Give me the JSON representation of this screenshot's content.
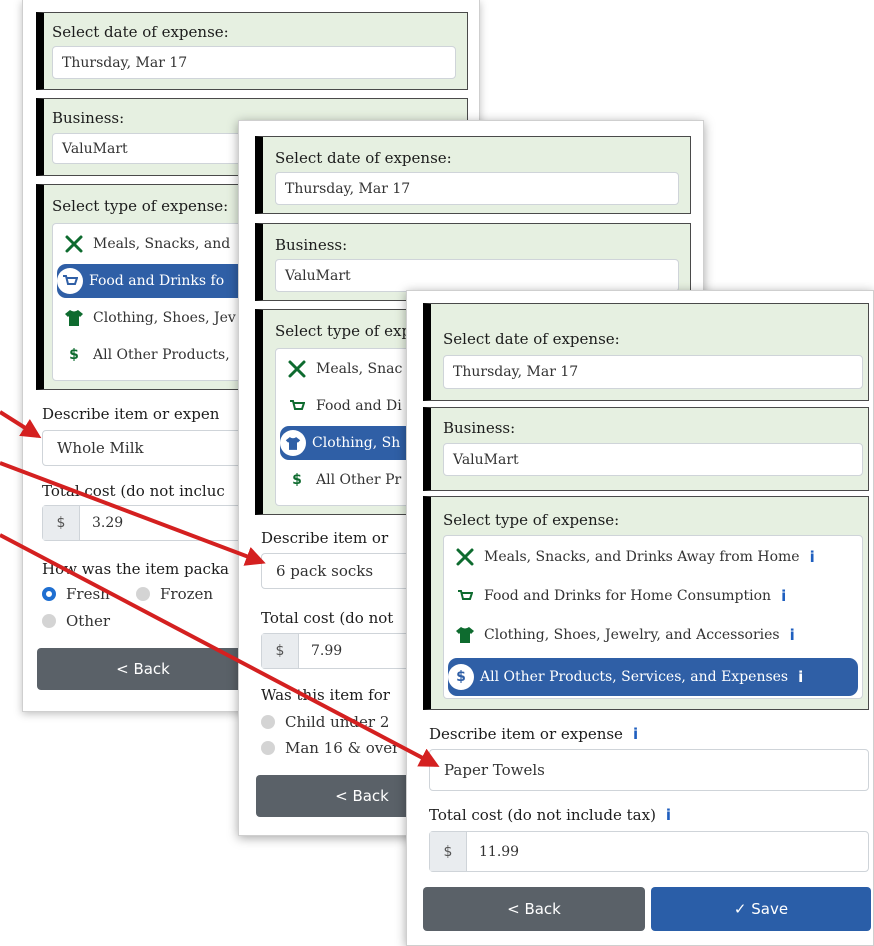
{
  "panel1": {
    "date_label": "Select date of expense:",
    "date_value": "Thursday, Mar 17",
    "business_label": "Business:",
    "business_value": "ValuMart",
    "type_label": "Select type of expense:",
    "options": [
      {
        "label": "Meals, Snacks, and",
        "icon": "utensils-icon"
      },
      {
        "label": "Food and Drinks fo",
        "icon": "cart-icon"
      },
      {
        "label": "Clothing, Shoes, Jev",
        "icon": "shirt-icon"
      },
      {
        "label": "All Other Products,",
        "icon": "dollar-icon"
      }
    ],
    "selected_index": 1,
    "describe_label": "Describe item or expen",
    "describe_value": "Whole Milk",
    "cost_label": "Total cost (do not incluc",
    "currency": "$",
    "cost_value": "3.29",
    "package_label": "How was the item packa",
    "radios": [
      {
        "label": "Fresh",
        "checked": true
      },
      {
        "label": "Frozen",
        "checked": false
      },
      {
        "label": "Other",
        "checked": false
      }
    ],
    "back_label": "< Back"
  },
  "panel2": {
    "date_label": "Select date of expense:",
    "date_value": "Thursday, Mar 17",
    "business_label": "Business:",
    "business_value": "ValuMart",
    "type_label": "Select type of exp",
    "options": [
      {
        "label": "Meals, Snac",
        "icon": "utensils-icon"
      },
      {
        "label": "Food and Di",
        "icon": "cart-icon"
      },
      {
        "label": "Clothing, Sh",
        "icon": "shirt-icon"
      },
      {
        "label": "All Other Pr",
        "icon": "dollar-icon"
      }
    ],
    "selected_index": 2,
    "describe_label": "Describe item or",
    "describe_value": "6 pack socks",
    "cost_label": "Total cost (do not",
    "currency": "$",
    "cost_value": "7.99",
    "for_label": "Was this item for",
    "radios": [
      {
        "label": "Child under 2",
        "checked": false
      },
      {
        "label": "Man 16 & over",
        "checked": false
      }
    ],
    "back_label": "< Back"
  },
  "panel3": {
    "date_label": "Select date of expense:",
    "date_value": "Thursday, Mar 17",
    "business_label": "Business:",
    "business_value": "ValuMart",
    "type_label": "Select type of expense:",
    "options": [
      {
        "label": "Meals, Snacks, and Drinks Away from Home",
        "icon": "utensils-icon"
      },
      {
        "label": "Food and Drinks for Home Consumption",
        "icon": "cart-icon"
      },
      {
        "label": "Clothing, Shoes, Jewelry, and Accessories",
        "icon": "shirt-icon"
      },
      {
        "label": "All Other Products, Services, and Expenses",
        "icon": "dollar-icon"
      }
    ],
    "selected_index": 3,
    "info_glyph": "i",
    "describe_label": "Describe item or expense",
    "describe_value": "Paper Towels",
    "cost_label": "Total cost (do not include tax)",
    "currency": "$",
    "cost_value": "11.99",
    "back_label": "< Back",
    "save_label": "✓ Save"
  },
  "colors": {
    "section_bg": "#e6f0e1",
    "selected_bg": "#2f5fa6",
    "save_bg": "#2a5ea8",
    "back_bg": "#5a6168",
    "arrow": "#d42020",
    "icon_green": "#0e6b2f",
    "info_blue": "#1f5fbf"
  }
}
